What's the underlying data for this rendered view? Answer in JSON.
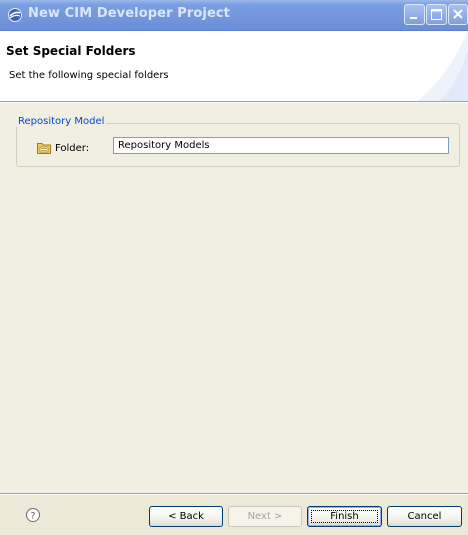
{
  "window": {
    "title": "New CIM Developer Project",
    "icon": "eclipse-icon"
  },
  "title_buttons": [
    "minimize-button",
    "maximize-button",
    "close-button"
  ],
  "header": {
    "page_title": "Set Special Folders",
    "page_description": "Set the following special folders"
  },
  "group": {
    "legend": "Repository Model",
    "folder_label": "Folder:",
    "folder_value": "Repository Models"
  },
  "footer": {
    "help_icon": "help-icon",
    "back_label": "< Back",
    "next_label": "Next >",
    "finish_label": "Finish",
    "cancel_label": "Cancel"
  },
  "colors": {
    "legend": "#0046d5",
    "dialog_bg": "#f1efe2",
    "titlebar": "#7596de"
  }
}
